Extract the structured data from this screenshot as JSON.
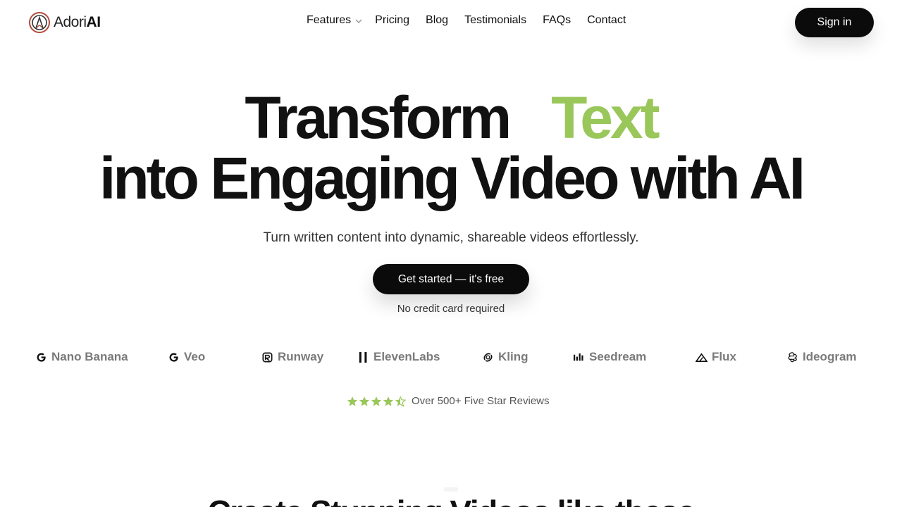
{
  "brand": {
    "name_light": "Adori",
    "name_bold": "AI"
  },
  "nav": {
    "items": [
      {
        "label": "Features"
      },
      {
        "label": "Pricing"
      },
      {
        "label": "Blog"
      },
      {
        "label": "Testimonials"
      },
      {
        "label": "FAQs"
      },
      {
        "label": "Contact"
      }
    ],
    "sign_in": "Sign in"
  },
  "hero": {
    "line1_a": "Transform",
    "line1_accent": "Text",
    "line2": "into Engaging Video with AI",
    "subtitle": "Turn written content into dynamic, shareable videos effortlessly.",
    "cta": "Get started — it's free",
    "cta_note": "No credit card required"
  },
  "models": [
    {
      "name": "Nano Banana",
      "icon": "google-icon"
    },
    {
      "name": "Veo",
      "icon": "google-icon"
    },
    {
      "name": "Runway",
      "icon": "runway-icon"
    },
    {
      "name": "ElevenLabs",
      "icon": "elevenlabs-icon"
    },
    {
      "name": "Kling",
      "icon": "kling-icon"
    },
    {
      "name": "Seedream",
      "icon": "seedream-icon"
    },
    {
      "name": "Flux",
      "icon": "flux-icon"
    },
    {
      "name": "Ideogram",
      "icon": "ideogram-icon"
    }
  ],
  "rating": {
    "stars": 4.5,
    "text": "Over 500+ Five Star Reviews"
  },
  "section": {
    "heading": "Create Stunning Videos like these"
  },
  "colors": {
    "accent": "#99c75a",
    "button": "#0b0b0b",
    "brand_gray": "#7a7a7a"
  }
}
